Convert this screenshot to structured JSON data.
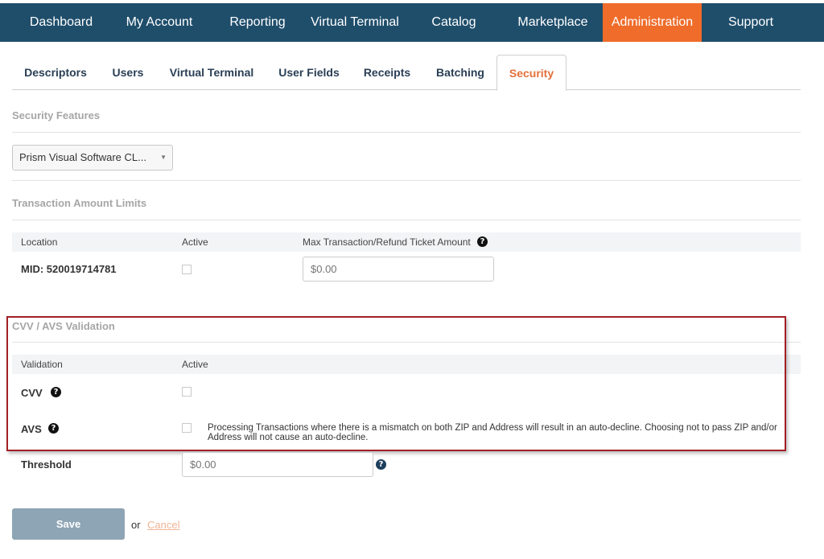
{
  "topnav": {
    "items": [
      {
        "label": "Dashboard"
      },
      {
        "label": "My Account"
      },
      {
        "label": "Reporting"
      },
      {
        "label": "Virtual Terminal"
      },
      {
        "label": "Catalog"
      },
      {
        "label": "Marketplace"
      },
      {
        "label": "Administration",
        "active": true
      },
      {
        "label": "Support"
      }
    ],
    "bg_color": "#1f4e6b",
    "active_color": "#ef6c2a"
  },
  "tabs": {
    "items": [
      {
        "label": "Descriptors"
      },
      {
        "label": "Users"
      },
      {
        "label": "Virtual Terminal"
      },
      {
        "label": "User Fields"
      },
      {
        "label": "Receipts"
      },
      {
        "label": "Batching"
      },
      {
        "label": "Security",
        "active": true
      }
    ],
    "active_color": "#e2703a"
  },
  "security_features": {
    "title": "Security Features",
    "select_value": "Prism Visual Software CL..."
  },
  "amount_limits": {
    "title": "Transaction Amount Limits",
    "headers": {
      "location": "Location",
      "active": "Active",
      "max_amount": "Max Transaction/Refund Ticket Amount"
    },
    "row": {
      "location": "MID: 520019714781",
      "amount_placeholder": "$0.00"
    }
  },
  "cvv_avs": {
    "title": "CVV / AVS Validation",
    "headers": {
      "validation": "Validation",
      "active": "Active"
    },
    "cvv_label": "CVV",
    "avs_label": "AVS",
    "avs_note": "Processing Transactions where there is a mismatch on both ZIP and Address will result in an auto-decline. Choosing not to pass ZIP and/or Address will not cause an auto-decline.",
    "threshold_label": "Threshold",
    "threshold_placeholder": "$0.00",
    "highlight_color": "#a31f25"
  },
  "actions": {
    "save_label": "Save",
    "or_text": "or",
    "cancel_label": "Cancel"
  },
  "icons": {
    "help": "?"
  }
}
